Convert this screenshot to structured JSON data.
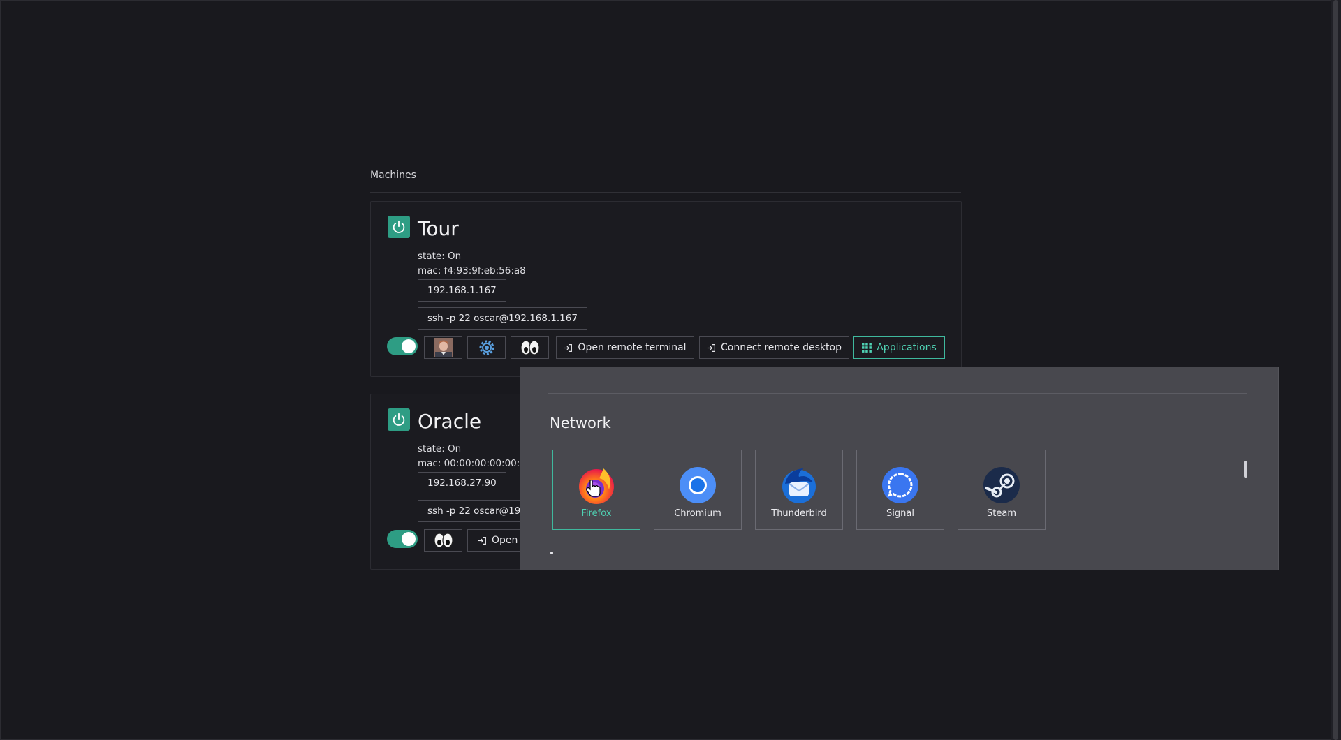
{
  "section_title": "Machines",
  "machines": [
    {
      "name": "Tour",
      "state": "state: On",
      "mac": "mac: f4:93:9f:eb:56:a8",
      "ip": "192.168.1.167",
      "ssh": "ssh -p 22 oscar@192.168.1.167",
      "toggle_on": true,
      "actions": {
        "terminal_label": "Open remote terminal",
        "desktop_label": "Connect remote desktop",
        "applications_label": "Applications"
      }
    },
    {
      "name": "Oracle",
      "state": "state: On",
      "mac": "mac: 00:00:00:00:00:0",
      "ip": "192.168.27.90",
      "ssh": "ssh -p 22 oscar@19",
      "toggle_on": true,
      "actions": {
        "terminal_label": "Open"
      }
    }
  ],
  "applications_popup": {
    "category": "Network",
    "apps": [
      {
        "label": "Firefox",
        "icon": "firefox-icon",
        "selected": true
      },
      {
        "label": "Chromium",
        "icon": "chromium-icon",
        "selected": false
      },
      {
        "label": "Thunderbird",
        "icon": "thunderbird-icon",
        "selected": false
      },
      {
        "label": "Signal",
        "icon": "signal-icon",
        "selected": false
      },
      {
        "label": "Steam",
        "icon": "steam-icon",
        "selected": false
      }
    ]
  },
  "colors": {
    "background": "#19191e",
    "accent": "#2e9d84",
    "accent_text": "#4fd1b3",
    "popup_bg": "#48484e"
  }
}
